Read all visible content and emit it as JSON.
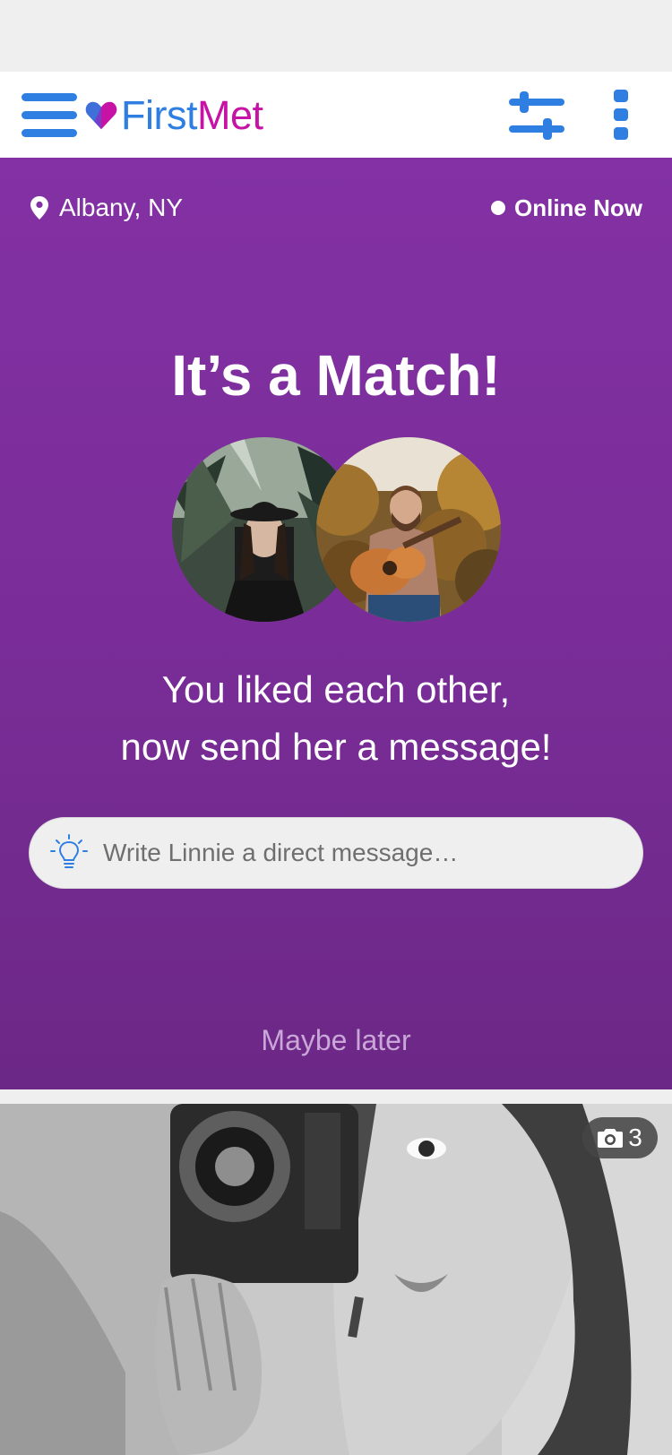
{
  "header": {
    "brand_first": "First",
    "brand_met": "Met",
    "menu_icon": "hamburger-icon",
    "filter_icon": "sliders-icon",
    "more_icon": "vertical-dots-icon",
    "colors": {
      "brand_blue": "#2f7fe2",
      "brand_magenta": "#c613a6"
    }
  },
  "match": {
    "location": "Albany, NY",
    "online_status": "Online Now",
    "title": "It’s a Match!",
    "subtitle_line1": "You liked each other,",
    "subtitle_line2": "now send her a message!",
    "message_placeholder": "Write Linnie a direct message…",
    "maybe_later": "Maybe later",
    "background_color": "#7d2e9c"
  },
  "profile": {
    "photo_count": "3",
    "camera_icon": "camera-icon"
  }
}
